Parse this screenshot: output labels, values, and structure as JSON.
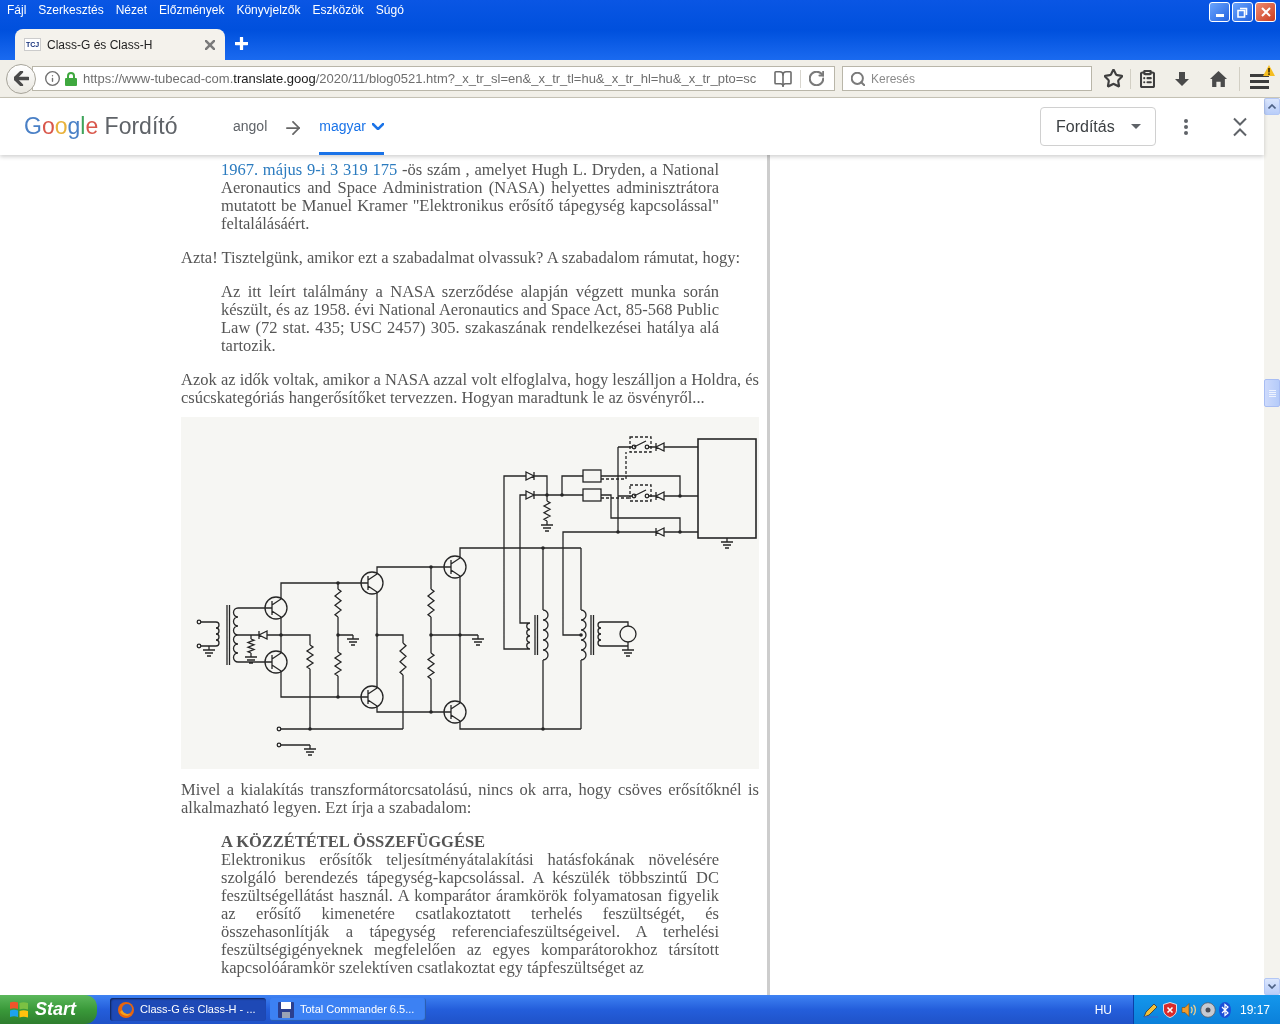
{
  "menu_bar": {
    "items": [
      "Fájl",
      "Szerkesztés",
      "Nézet",
      "Előzmények",
      "Könyvjelzők",
      "Eszközök",
      "Súgó"
    ]
  },
  "tabs": [
    {
      "favicon_text": "TCJ",
      "title": "Class-G és Class-H",
      "selected": true
    }
  ],
  "address_bar": {
    "url_start": "https://www-tubecad-com.",
    "url_domain": "translate.goog",
    "url_end": "/2020/11/blog0521.htm?_x_tr_sl=en&_x_tr_tl=hu&_x_tr_hl=hu&_x_tr_pto=sc"
  },
  "search": {
    "placeholder": "Keresés"
  },
  "translate_bar": {
    "logo": "Google",
    "product": "Fordító",
    "languages": [
      {
        "label": "angol",
        "selected": false
      },
      {
        "label": "magyar",
        "selected": true
      }
    ],
    "translate_button": "Fordítás"
  },
  "article": {
    "blocks": [
      {
        "kind": "quote",
        "link": "1967. május 9-i 3 319 175",
        "text": " -ös szám , amelyet Hugh L. Dryden, a National Aeronautics and Space Administration (NASA) helyettes adminisztrátora mutatott be Manuel Kramer \"Elektronikus erősítő tápegység kapcsolással\" feltalálásáért."
      },
      {
        "kind": "paragraph",
        "text": "Azta! Tisztelgünk, amikor ezt a szabadalmat olvassuk? A szabadalom rámutat, hogy:"
      },
      {
        "kind": "quote",
        "text": "Az itt leírt találmány a NASA szerződése alapján végzett munka során készült, és az 1958. évi National Aeronautics and Space Act, 85-568 Public Law (72 stat. 435; USC 2457) 305. szakaszának rendelkezései hatálya alá tartozik."
      },
      {
        "kind": "paragraph",
        "text": "Azok az idők voltak, amikor a NASA azzal volt elfoglalva, hogy leszálljon a Holdra, és csúcskategóriás hangerősítőket tervezzen. Hogyan maradtunk le az ösvényről..."
      },
      {
        "kind": "figure"
      },
      {
        "kind": "paragraph",
        "text": "Mivel a kialakítás transzformátorcsatolású, nincs ok arra, hogy csöves erősítőknél is alkalmazható legyen. Ezt írja a szabadalom:"
      },
      {
        "kind": "quote",
        "heading": "A KÖZZÉTÉTEL ÖSSZEFÜGGÉSE",
        "text": "Elektronikus erősítők teljesítményátalakítási hatásfokának növelésére szolgáló berendezés tápegység-kapcsolással. A készülék többszintű DC feszültségellátást használ. A komparátor áramkörök folyamatosan figyelik az erősítő kimenetére csatlakoztatott terhelés feszültségét, és összehasonlítják a tápegység referenciafeszültségeivel. A terhelési feszültségigényeknek megfelelően az egyes komparátorokhoz társított kapcsolóáramkör szelektíven csatlakoztat egy tápfeszültséget az"
      }
    ]
  },
  "taskbar": {
    "start": "Start",
    "tasks": [
      {
        "kind": "browser",
        "label": "Class-G és Class-H - ...",
        "selected": true
      },
      {
        "kind": "file_manager",
        "label": "Total Commander 6.5...",
        "selected": false
      }
    ],
    "language": "HU",
    "clock": "19:17"
  }
}
